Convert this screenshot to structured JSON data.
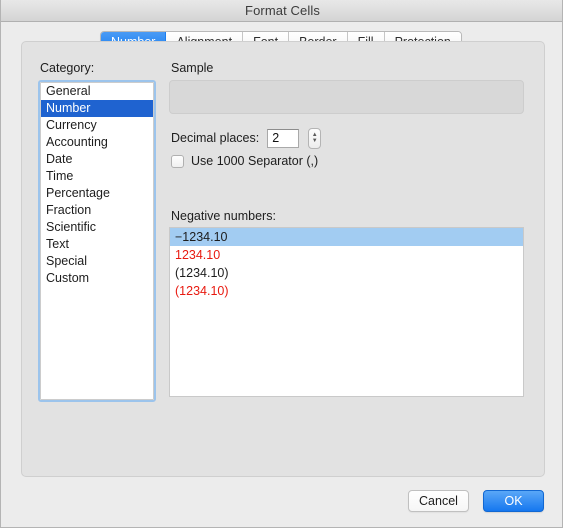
{
  "window": {
    "title": "Format Cells"
  },
  "tabs": [
    {
      "label": "Number",
      "active": true
    },
    {
      "label": "Alignment",
      "active": false
    },
    {
      "label": "Font",
      "active": false
    },
    {
      "label": "Border",
      "active": false
    },
    {
      "label": "Fill",
      "active": false
    },
    {
      "label": "Protection",
      "active": false
    }
  ],
  "category": {
    "label": "Category:",
    "items": [
      {
        "label": "General",
        "selected": false
      },
      {
        "label": "Number",
        "selected": true
      },
      {
        "label": "Currency",
        "selected": false
      },
      {
        "label": "Accounting",
        "selected": false
      },
      {
        "label": "Date",
        "selected": false
      },
      {
        "label": "Time",
        "selected": false
      },
      {
        "label": "Percentage",
        "selected": false
      },
      {
        "label": "Fraction",
        "selected": false
      },
      {
        "label": "Scientific",
        "selected": false
      },
      {
        "label": "Text",
        "selected": false
      },
      {
        "label": "Special",
        "selected": false
      },
      {
        "label": "Custom",
        "selected": false
      }
    ]
  },
  "sample": {
    "label": "Sample",
    "value": ""
  },
  "decimal_places": {
    "label": "Decimal places:",
    "value": "2",
    "stepper_up": "▲",
    "stepper_down": "▼"
  },
  "thousands_separator": {
    "label": "Use 1000 Separator (,)",
    "checked": false
  },
  "negative_numbers": {
    "label": "Negative numbers:",
    "items": [
      {
        "text": "−1234.10",
        "color": "#1d1d1d",
        "selected": true
      },
      {
        "text": "1234.10",
        "color": "#e8190f",
        "selected": false
      },
      {
        "text": "(1234.10)",
        "color": "#1d1d1d",
        "selected": false
      },
      {
        "text": "(1234.10)",
        "color": "#e8190f",
        "selected": false
      }
    ]
  },
  "footer": {
    "cancel_label": "Cancel",
    "ok_label": "OK"
  },
  "colors": {
    "accent_blue": "#1b7ef0",
    "selection_blue": "#1f63d0",
    "row_selection_blue": "#a2ccf2",
    "negative_red": "#e8190f",
    "panel_gray": "#e2e2e2",
    "dialog_gray": "#ececec"
  }
}
